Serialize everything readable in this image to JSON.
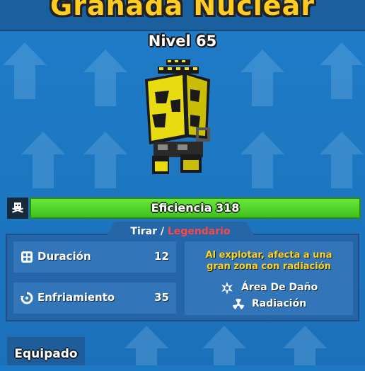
{
  "header": {
    "title": "Granada Nuclear"
  },
  "item": {
    "level_text": "Nivel 65"
  },
  "efficiency": {
    "label": "Eficiencia 318",
    "icon": "skull-icon"
  },
  "category": {
    "type": "Tirar",
    "separator": " / ",
    "rarity": "Legendario",
    "rarity_color": "#ff4646"
  },
  "stats": [
    {
      "label": "Duración",
      "value": "12",
      "icon": "duration-icon"
    },
    {
      "label": "Enfriamiento",
      "value": "35",
      "icon": "cooldown-icon"
    }
  ],
  "description": {
    "line1": "Al explotar, afecta a una",
    "line2": "gran zona con radiación",
    "color": "#ffd21e"
  },
  "properties": [
    {
      "label": "Área De Daño",
      "icon": "explosion-icon"
    },
    {
      "label": "Radiación",
      "icon": "radiation-icon"
    }
  ],
  "footer": {
    "equip_label": "Equipado"
  },
  "colors": {
    "title": "#ffcc1f",
    "efficiency_bar": "#4fd22a",
    "background": "#1d78c4"
  }
}
